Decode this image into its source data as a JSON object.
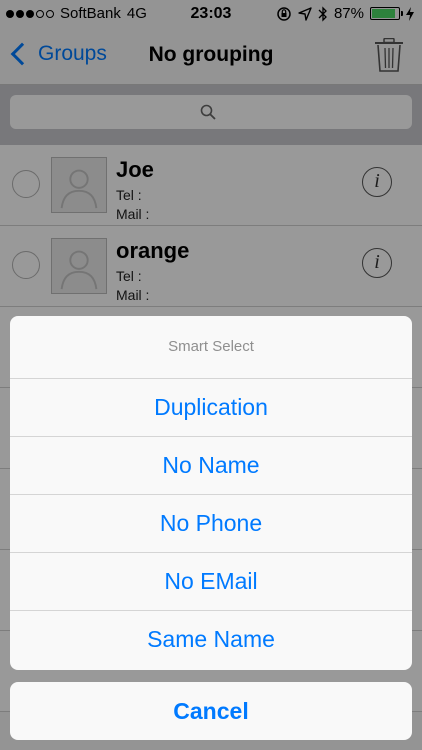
{
  "status_bar": {
    "carrier": "SoftBank",
    "network": "4G",
    "time": "23:03",
    "battery": "87%",
    "signal_bars_filled": 3,
    "signal_bars_total": 5,
    "battery_level": 0.87
  },
  "nav": {
    "back_label": "Groups",
    "title": "No grouping",
    "trash_icon": "trash-icon"
  },
  "search": {
    "icon": "search-icon",
    "placeholder": ""
  },
  "contacts": [
    {
      "name": "Joe",
      "tel_label": "Tel :",
      "mail_label": "Mail :"
    },
    {
      "name": "orange",
      "tel_label": "Tel :",
      "mail_label": "Mail :"
    }
  ],
  "action_sheet": {
    "title": "Smart Select",
    "items": [
      "Duplication",
      "No Name",
      "No Phone",
      "No EMail",
      "Same Name"
    ],
    "cancel": "Cancel"
  },
  "colors": {
    "accent": "#007aff",
    "battery_fill": "#4cd964"
  }
}
